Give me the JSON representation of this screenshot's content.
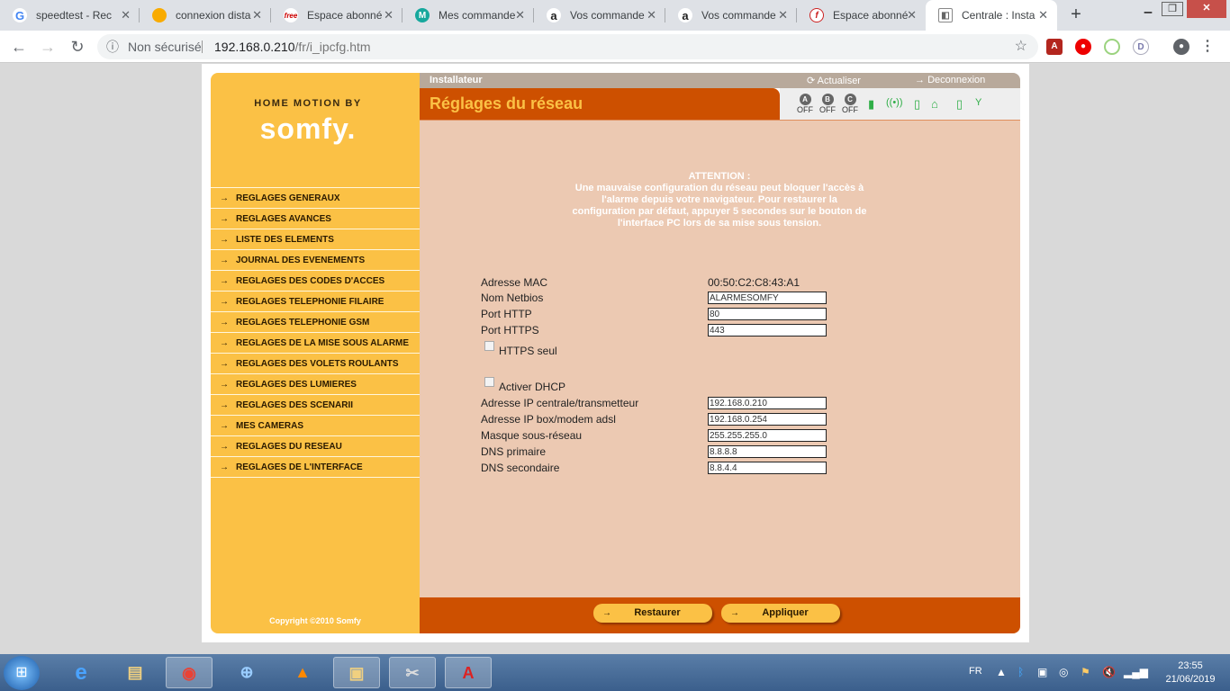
{
  "browser": {
    "tabs": [
      {
        "title": "speedtest - Rec",
        "icon": "google-icon",
        "color": "#4285f4",
        "glyph": "G"
      },
      {
        "title": "connexion dista",
        "icon": "circle-icon",
        "color": "#f9ab00",
        "glyph": "●"
      },
      {
        "title": "Espace abonné",
        "icon": "free-icon",
        "color": "#cc0000",
        "glyph": "free"
      },
      {
        "title": "Mes commande",
        "icon": "m-icon",
        "color": "#16a89d",
        "glyph": "M"
      },
      {
        "title": "Vos commande",
        "icon": "amazon-icon",
        "color": "#222222",
        "glyph": "a"
      },
      {
        "title": "Vos commande",
        "icon": "amazon-icon",
        "color": "#222222",
        "glyph": "a"
      },
      {
        "title": "Espace abonné",
        "icon": "f-icon",
        "color": "#cc2222",
        "glyph": "f"
      },
      {
        "title": "Centrale : Insta",
        "icon": "page-icon",
        "color": "#666666",
        "glyph": "◧"
      }
    ],
    "new_tab": "+",
    "security_label": "Non sécurisé",
    "url_host": "192.168.0.210",
    "url_path": "/fr/i_ipcfg.htm"
  },
  "brand": {
    "top": "HOME MOTION BY",
    "main": "somfy."
  },
  "menu": [
    "REGLAGES GENERAUX",
    "REGLAGES AVANCES",
    "LISTE DES ELEMENTS",
    "JOURNAL DES EVENEMENTS",
    "REGLAGES DES CODES D'ACCES",
    "REGLAGES TELEPHONIE FILAIRE",
    "REGLAGES TELEPHONIE GSM",
    "REGLAGES DE LA MISE SOUS ALARME",
    "REGLAGES DES VOLETS ROULANTS",
    "REGLAGES DES LUMIERES",
    "REGLAGES DES SCENARII",
    "MES CAMERAS",
    "REGLAGES DU RESEAU",
    "REGLAGES DE L'INTERFACE"
  ],
  "copyright": "Copyright ©2010 Somfy",
  "header": {
    "role": "Installateur",
    "refresh": "Actualiser",
    "logout": "Deconnexion",
    "title": "Réglages du réseau"
  },
  "zones": [
    {
      "letter": "A",
      "state": "OFF"
    },
    {
      "letter": "B",
      "state": "OFF"
    },
    {
      "letter": "C",
      "state": "OFF"
    }
  ],
  "warning": {
    "title": "ATTENTION :",
    "text": "Une mauvaise configuration du réseau peut bloquer l'accès à l'alarme depuis votre navigateur. Pour restaurer la configuration par défaut, appuyer 5 secondes sur le bouton de l'interface PC lors de sa mise sous tension."
  },
  "form": {
    "mac_label": "Adresse MAC",
    "mac_value": "00:50:C2:C8:43:A1",
    "netbios_label": "Nom Netbios",
    "netbios_value": "ALARMESOMFY",
    "http_label": "Port HTTP",
    "http_value": "80",
    "https_label": "Port HTTPS",
    "https_value": "443",
    "https_only_label": "HTTPS seul",
    "dhcp_label": "Activer DHCP",
    "ip_label": "Adresse IP centrale/transmetteur",
    "ip_value": "192.168.0.210",
    "gateway_label": "Adresse IP box/modem adsl",
    "gateway_value": "192.168.0.254",
    "mask_label": "Masque sous-réseau",
    "mask_value": "255.255.255.0",
    "dns1_label": "DNS primaire",
    "dns1_value": "8.8.8.8",
    "dns2_label": "DNS secondaire",
    "dns2_value": "8.8.4.4"
  },
  "buttons": {
    "restore": "Restaurer",
    "apply": "Appliquer"
  },
  "taskbar": {
    "lang": "FR",
    "time": "23:55",
    "date": "21/06/2019"
  },
  "colors": {
    "sidebar": "#fbc145",
    "accent": "#cd5000",
    "content": "#ecc9b2"
  }
}
